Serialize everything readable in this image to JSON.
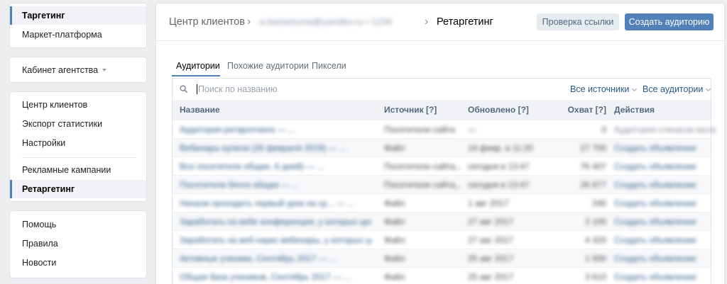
{
  "sidebar": {
    "group1": [
      {
        "label": "Таргетинг",
        "active": true
      },
      {
        "label": "Маркет-платформа",
        "active": false
      }
    ],
    "agency_label": "Кабинет агентства",
    "group3": [
      {
        "label": "Центр клиентов",
        "active": false
      },
      {
        "label": "Экспорт статистики",
        "active": false
      },
      {
        "label": "Настройки",
        "active": false
      },
      {
        "label": "Рекламные кампании",
        "active": false
      },
      {
        "label": "Ретаргетинг",
        "active": true
      }
    ],
    "group4": [
      {
        "label": "Помощь",
        "active": false
      },
      {
        "label": "Правила",
        "active": false
      },
      {
        "label": "Новости",
        "active": false
      }
    ]
  },
  "header": {
    "crumb_root": "Центр клиентов",
    "crumb_client": "a.bananovna@yandex.ru • 1234",
    "crumb_current": "Ретаргетинг",
    "check_link_label": "Проверка ссылки",
    "create_audience_label": "Создать аудиторию"
  },
  "tabs": [
    {
      "label": "Аудитории",
      "active": true
    },
    {
      "label": "Похожие аудитории",
      "active": false
    },
    {
      "label": "Пиксели",
      "active": false
    }
  ],
  "search": {
    "placeholder": "Поиск по названию",
    "value": ""
  },
  "filters": {
    "sources_label": "Все источники",
    "audiences_label": "Все аудитории"
  },
  "table": {
    "columns": {
      "name": "Название",
      "source": "Источник [?]",
      "updated": "Обновлено [?]",
      "reach": "Охват [?]",
      "actions": "Действия"
    },
    "rows": [
      {
        "name": "Аудитория ретаргетинга — ...",
        "source": "Посетители сайта",
        "updated": "—",
        "reach": "0",
        "action": "Аудитория слишком мала"
      },
      {
        "name": "Вебинары купили (26 февраля 2019) — ...",
        "source": "Файл",
        "updated": "14 февр. в 11:20",
        "reach": "27 700",
        "action": "Создать объявление"
      },
      {
        "name": "Все посетители общие, 6 дней) — ...",
        "source": "Посетители сайта,...",
        "updated": "сегодня в 13:47",
        "reach": "76 407",
        "action": "Создать объявление"
      },
      {
        "name": "Посетители блога общая — ...",
        "source": "Посетители сайта,...",
        "updated": "сегодня в 13:47",
        "reach": "26 877",
        "action": "Создать объявление"
      },
      {
        "name": "Начали проходить первый урок на ср... — ...",
        "source": "Файл",
        "updated": "1 авг 2017",
        "reach": "240",
        "action": "Создать объявление"
      },
      {
        "name": "Заработать на вебе конференция, у которых цели вы... — ...",
        "source": "Файл",
        "updated": "27 авг 2017",
        "reach": "2 100",
        "action": "Создать объявление"
      },
      {
        "name": "Заработать на веб-науке вебинары, у которых цели вы... — ...",
        "source": "Файл",
        "updated": "27 авг 2017",
        "reach": "4 320",
        "action": "Создать объявление"
      },
      {
        "name": "Активные ученики, Сентябрь 2017 — ...",
        "source": "Файл",
        "updated": "25 авг 2017",
        "reach": "1 930",
        "action": "Создать объявление"
      },
      {
        "name": "Общая база учеников, Сентябрь 2017 — ...",
        "source": "Файл",
        "updated": "25 авг 2017",
        "reach": "3 610",
        "action": "Создать объявление"
      }
    ]
  },
  "colors": {
    "accent": "#5181b8",
    "link": "#2a5885",
    "background": "#edeef0"
  },
  "icons": {
    "search": "search-icon",
    "breadcrumb_separator": "chevron-right-icon",
    "dropdown": "chevron-down-icon"
  }
}
